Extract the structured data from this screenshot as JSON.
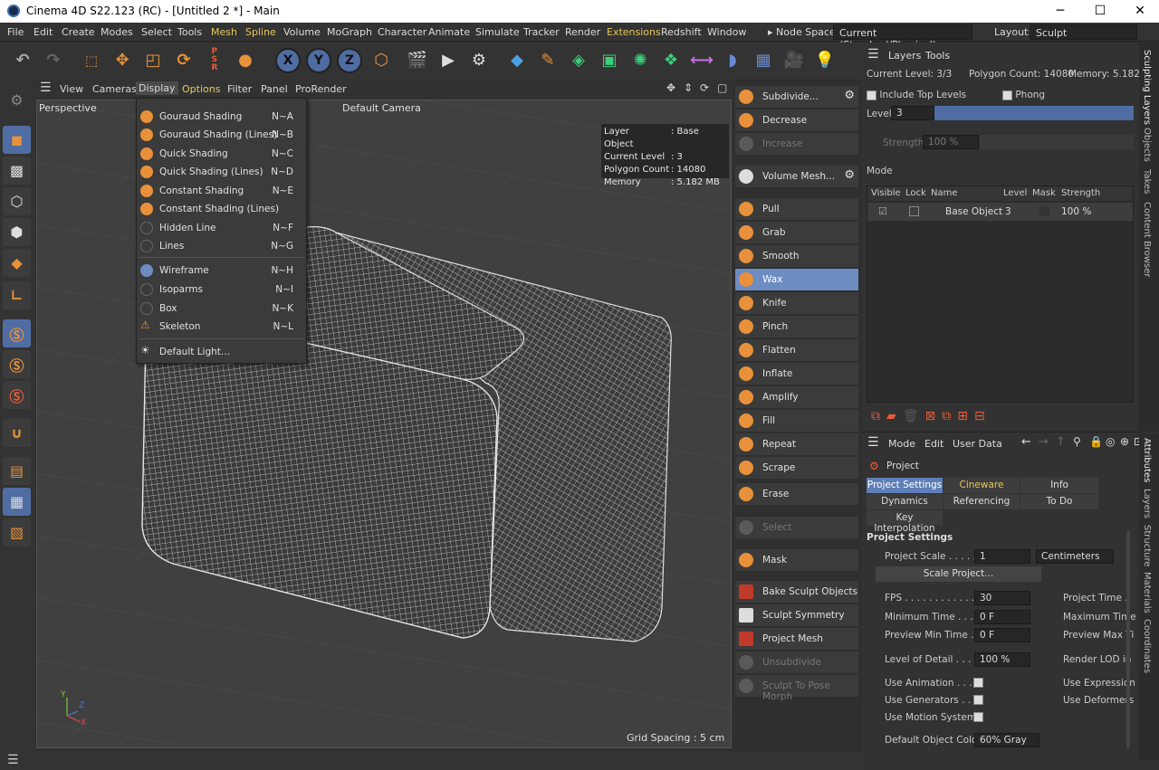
{
  "window": {
    "title": "Cinema 4D S22.123 (RC) - [Untitled 2 *] - Main",
    "minimize": "─",
    "maximize": "☐",
    "close": "✕"
  },
  "menubar": {
    "items": [
      "File",
      "Edit",
      "Create",
      "Modes",
      "Select",
      "Tools",
      "Mesh",
      "Spline",
      "Volume",
      "MoGraph",
      "Character",
      "Animate",
      "Simulate",
      "Tracker",
      "Render",
      "Extensions",
      "Redshift",
      "Window"
    ],
    "node_space_label": "Node Space:",
    "node_space_value": "Current (Standard/Physical)",
    "layout_label": "Layout:",
    "layout_value": "Sculpt"
  },
  "viewport": {
    "menu": [
      "View",
      "Cameras",
      "Display",
      "Options",
      "Filter",
      "Panel",
      "ProRender"
    ],
    "name": "Perspective",
    "camera": "Default Camera",
    "grid_spacing": "Grid Spacing : 5 cm",
    "hud": [
      {
        "k": "Layer",
        "v": ": Base Object"
      },
      {
        "k": "Current Level",
        "v": ": 3"
      },
      {
        "k": "Polygon Count",
        "v": ": 14080"
      },
      {
        "k": "Memory",
        "v": ": 5.182 MB"
      }
    ],
    "axes": {
      "y": "Y",
      "z": "Z",
      "x": "X"
    }
  },
  "display_menu": {
    "items": [
      {
        "label": "Gouraud Shading",
        "shortcut": "N~A",
        "icon": "gouraud-icon",
        "enabled": true
      },
      {
        "label": "Gouraud Shading (Lines)",
        "shortcut": "N~B",
        "icon": "gouraud-lines-icon",
        "enabled": true
      },
      {
        "label": "Quick Shading",
        "shortcut": "N~C",
        "icon": "quick-shading-icon",
        "enabled": true
      },
      {
        "label": "Quick Shading (Lines)",
        "shortcut": "N~D",
        "icon": "quick-lines-icon",
        "enabled": true
      },
      {
        "label": "Constant Shading",
        "shortcut": "N~E",
        "icon": "constant-icon",
        "enabled": true
      },
      {
        "label": "Constant Shading (Lines)",
        "shortcut": "",
        "icon": "constant-lines-icon",
        "enabled": true
      },
      {
        "label": "Hidden Line",
        "shortcut": "N~F",
        "icon": "hidden-line-icon",
        "enabled": false
      },
      {
        "label": "Lines",
        "shortcut": "N~G",
        "icon": "lines-icon",
        "enabled": false
      },
      {
        "label": "Wireframe",
        "shortcut": "N~H",
        "icon": "wireframe-icon",
        "enabled": true
      },
      {
        "label": "Isoparms",
        "shortcut": "N~I",
        "icon": "isoparms-icon",
        "enabled": false
      },
      {
        "label": "Box",
        "shortcut": "N~K",
        "icon": "box-icon",
        "enabled": false
      },
      {
        "label": "Skeleton",
        "shortcut": "N~L",
        "icon": "skeleton-icon",
        "enabled": false
      },
      {
        "label": "Default Light...",
        "shortcut": "",
        "icon": "light-icon",
        "enabled": true
      }
    ]
  },
  "sculpt_tools": [
    {
      "label": "Subdivide...",
      "state": "normal"
    },
    {
      "label": "Decrease",
      "state": "normal"
    },
    {
      "label": "Increase",
      "state": "disabled"
    },
    {
      "label": "Volume Mesh...",
      "state": "normal"
    },
    {
      "label": "Pull",
      "state": "normal"
    },
    {
      "label": "Grab",
      "state": "normal"
    },
    {
      "label": "Smooth",
      "state": "normal"
    },
    {
      "label": "Wax",
      "state": "active"
    },
    {
      "label": "Knife",
      "state": "normal"
    },
    {
      "label": "Pinch",
      "state": "normal"
    },
    {
      "label": "Flatten",
      "state": "normal"
    },
    {
      "label": "Inflate",
      "state": "normal"
    },
    {
      "label": "Amplify",
      "state": "normal"
    },
    {
      "label": "Fill",
      "state": "normal"
    },
    {
      "label": "Repeat",
      "state": "normal"
    },
    {
      "label": "Scrape",
      "state": "normal"
    },
    {
      "label": "Erase",
      "state": "normal"
    },
    {
      "label": "Select",
      "state": "disabled"
    },
    {
      "label": "Mask",
      "state": "normal"
    },
    {
      "label": "Bake Sculpt Objects",
      "state": "normal"
    },
    {
      "label": "Sculpt Symmetry",
      "state": "normal"
    },
    {
      "label": "Project Mesh",
      "state": "normal"
    },
    {
      "label": "Unsubdivide",
      "state": "disabled"
    },
    {
      "label": "Sculpt To Pose Morph",
      "state": "disabled"
    }
  ],
  "layers_panel": {
    "tabs": [
      "Layers",
      "Tools"
    ],
    "current_level": "Current Level: 3/3",
    "polygon_count": "Polygon Count: 14080",
    "memory": "Memory: 5.182",
    "include_top": "Include Top Levels",
    "phong": "Phong",
    "level_label": "Level",
    "level_value": "3",
    "strength_label": "Strength",
    "strength_value": "100 %",
    "mode_label": "Mode",
    "columns": [
      "Visible",
      "Lock",
      "Name",
      "Level",
      "Mask",
      "Strength"
    ],
    "rows": [
      {
        "name": "Base Object",
        "level": "3",
        "strength": "100 %"
      }
    ]
  },
  "attributes": {
    "menu": [
      "Mode",
      "Edit",
      "User Data"
    ],
    "object": "Project",
    "tabs": [
      {
        "label": "Project Settings",
        "active": true
      },
      {
        "label": "Cineware",
        "active": false
      },
      {
        "label": "Info",
        "active": false
      },
      {
        "label": "Dynamics",
        "active": false
      },
      {
        "label": "Referencing",
        "active": false
      },
      {
        "label": "To Do",
        "active": false
      },
      {
        "label": "Key Interpolation",
        "active": false
      }
    ],
    "section": "Project Settings",
    "project_scale_label": "Project Scale . . . . .",
    "project_scale_value": "1",
    "unit": "Centimeters",
    "scale_button": "Scale Project...",
    "fps_label": "FPS . . . . . . . . . . . .",
    "fps_value": "30",
    "project_time_label": "Project Time .",
    "min_time_label": "Minimum Time . . .",
    "min_time_value": "0 F",
    "max_time_label": "Maximum Time",
    "prev_min_label": "Preview Min Time . .",
    "prev_min_value": "0 F",
    "prev_max_label": "Preview Max Ti",
    "lod_label": "Level of Detail . . . .",
    "lod_value": "100 %",
    "render_lod_label": "Render LOD in",
    "use_animation": "Use Animation . . . .",
    "use_expression": "Use Expression",
    "use_generators": "Use Generators . . .",
    "use_deformers": "Use Deformers",
    "use_motion": "Use Motion System",
    "default_color_label": "Default Object Color",
    "default_color_value": "60% Gray"
  },
  "right_vtabs_top": [
    "Sculpting Layers",
    "Objects",
    "Takes",
    "Content Browser"
  ],
  "right_vtabs_bottom": [
    "Attributes",
    "Layers",
    "Structure",
    "Materials",
    "Coordinates"
  ],
  "colors": {
    "accent": "#5e7fb8",
    "orange": "#e8913a",
    "highlight": "#e5c85c"
  }
}
